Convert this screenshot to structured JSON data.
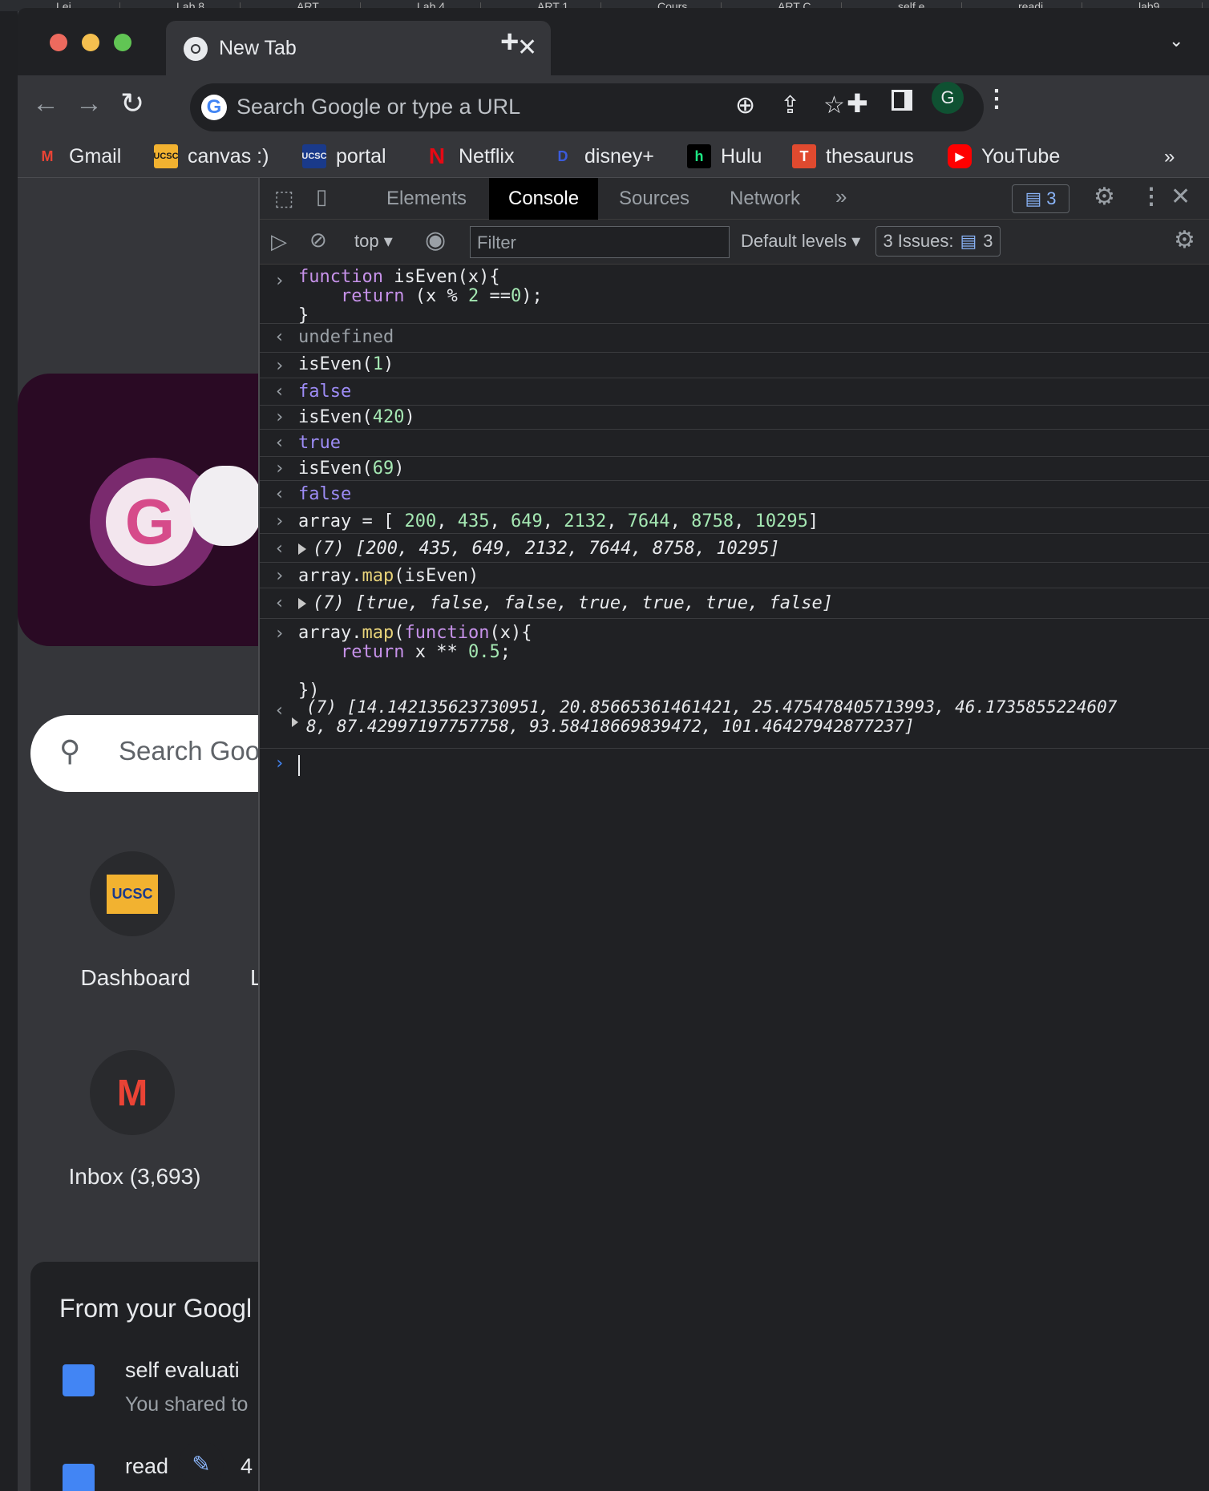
{
  "top_tabs": [
    "Lei",
    "Lab 8",
    "ART",
    "Lab 4",
    "ART 1",
    "Cours",
    "ART C",
    "self e",
    "readi",
    "lab9"
  ],
  "browser": {
    "tab_title": "New Tab",
    "omnibox_placeholder": "Search Google or type a URL",
    "profile_initial": "G"
  },
  "bookmarks": [
    {
      "label": "Gmail",
      "icon": "gmail-icon"
    },
    {
      "label": "canvas :)",
      "icon": "ucsc-icon"
    },
    {
      "label": "portal",
      "icon": "ucsc-icon"
    },
    {
      "label": "Netflix",
      "icon": "netflix-icon"
    },
    {
      "label": "disney+",
      "icon": "disney-icon"
    },
    {
      "label": "Hulu",
      "icon": "hulu-icon"
    },
    {
      "label": "thesaurus",
      "icon": "thesaurus-icon"
    },
    {
      "label": "YouTube",
      "icon": "youtube-icon"
    }
  ],
  "ntp": {
    "search_placeholder": "Search Goo",
    "shortcuts": [
      {
        "label": "Dashboard",
        "icon": "ucsc-icon",
        "icon_text": "UCSC"
      },
      {
        "label": "Inbox (3,693)",
        "icon": "gmail-icon"
      }
    ],
    "partial_shortcut_letter": "L",
    "drive_title": "From your Googl",
    "drive_items": [
      {
        "title": "self evaluati",
        "subtitle": "You shared to"
      },
      {
        "title": "read",
        "subtitle": ""
      }
    ],
    "edit_badge": "4"
  },
  "devtools": {
    "tabs": [
      "Elements",
      "Console",
      "Sources",
      "Network"
    ],
    "active_tab": "Console",
    "message_count": "3",
    "context": "top",
    "filter_placeholder": "Filter",
    "levels": "Default levels",
    "issues_label": "3 Issues:",
    "issues_count": "3"
  },
  "console": {
    "entries": [
      {
        "type": "input",
        "lines": [
          "function isEven(x){",
          "    return (x % 2 ==0);",
          "}"
        ]
      },
      {
        "type": "output",
        "text": "undefined"
      },
      {
        "type": "input",
        "lines": [
          "isEven(1)"
        ]
      },
      {
        "type": "output",
        "text": "false"
      },
      {
        "type": "input",
        "lines": [
          "isEven(420)"
        ]
      },
      {
        "type": "output",
        "text": "true"
      },
      {
        "type": "input",
        "lines": [
          "isEven(69)"
        ]
      },
      {
        "type": "output",
        "text": "false"
      },
      {
        "type": "input",
        "lines": [
          "array = [ 200, 435, 649, 2132, 7644, 8758, 10295]"
        ]
      },
      {
        "type": "output",
        "text": "(7) [200, 435, 649, 2132, 7644, 8758, 10295]"
      },
      {
        "type": "input",
        "lines": [
          "array.map(isEven)"
        ]
      },
      {
        "type": "output",
        "text": "(7) [true, false, false, true, true, true, false]"
      },
      {
        "type": "input",
        "lines": [
          "array.map(function(x){",
          "    return x ** 0.5;",
          "",
          "})"
        ]
      },
      {
        "type": "output",
        "text": "(7) [14.142135623730951, 20.85665361461421, 25.475478405713993, 46.1735855224607",
        "text2": "8, 87.42997197757758, 93.58418669839472, 101.46427942877237]"
      }
    ]
  },
  "colors": {
    "output_purple": "#9d8cf5",
    "number_green": "#a5e8b3",
    "keyword": "#c792ea",
    "devtools_bg": "#202124"
  }
}
